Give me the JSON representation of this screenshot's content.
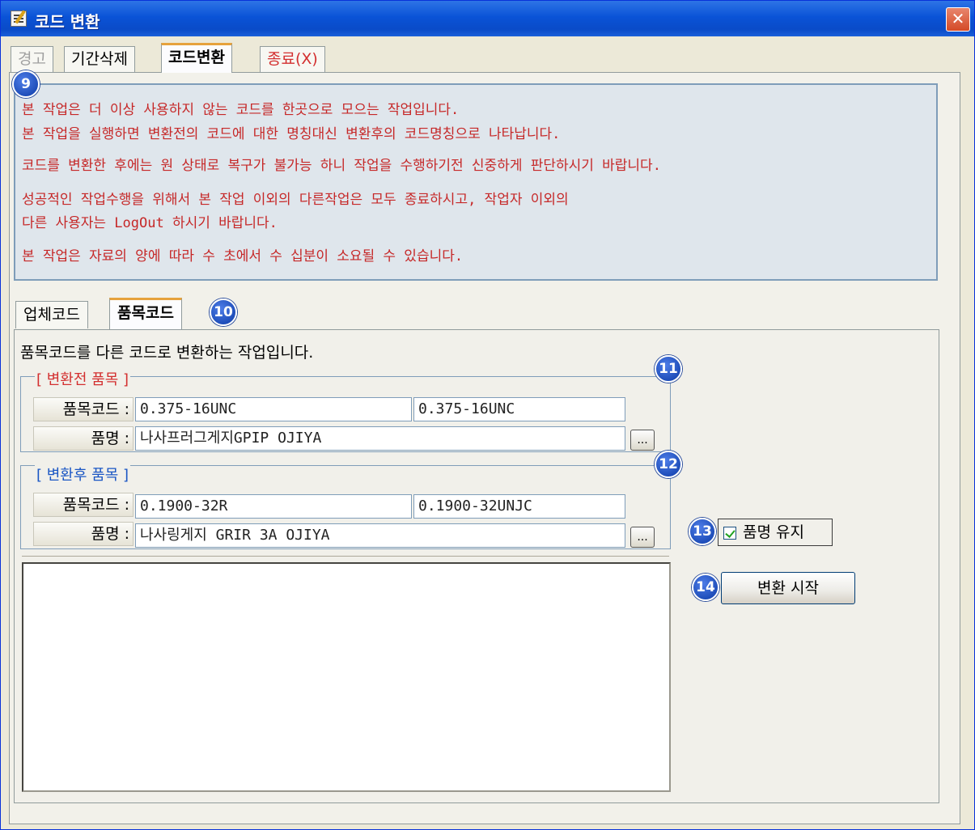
{
  "window": {
    "title": "코드 변환",
    "close_label": "✕"
  },
  "top_tabs": [
    {
      "label": "경고",
      "state": "disabled"
    },
    {
      "label": "기간삭제",
      "state": "normal"
    },
    {
      "label": "코드변환",
      "state": "active"
    },
    {
      "label": "종료(X)",
      "state": "red"
    }
  ],
  "notice": {
    "badge": "9",
    "lines": [
      "본 작업은 더 이상 사용하지 않는 코드를 한곳으로 모으는 작업입니다.",
      " 본 작업을 실행하면 변환전의 코드에 대한 명칭대신 변환후의 코드명칭으로 나타납니다.",
      "코드를 변환한 후에는 원 상태로 복구가 불가능 하니 작업을 수행하기전 신중하게 판단하시기 바랍니다.",
      "성공적인 작업수행을 위해서 본 작업 이외의 다른작업은 모두 종료하시고, 작업자 이외의",
      " 다른 사용자는 LogOut 하시기 바랍니다.",
      "본 작업은 자료의 양에 따라 수 초에서 수 십분이 소요될 수 있습니다."
    ]
  },
  "inner_tabs": [
    {
      "label": "업체코드",
      "state": "normal"
    },
    {
      "label": "품목코드",
      "state": "active"
    }
  ],
  "inner_tabs_badge": "10",
  "description": "품목코드를 다른 코드로 변환하는 작업입니다.",
  "before_group": {
    "title": "[ 변환전 품목 ]",
    "badge": "11",
    "code_label": "품목코드 :",
    "code_value": "0.375-16UNC",
    "code_value2": "0.375-16UNC",
    "name_label": "품명 :",
    "name_value": "나사프러그게지GPIP      OJIYA",
    "browse_label": "..."
  },
  "after_group": {
    "title": "[ 변환후 품목 ]",
    "badge": "12",
    "code_label": "품목코드 :",
    "code_value": "0.1900-32R",
    "code_value2": "0.1900-32UNJC",
    "name_label": "품명 :",
    "name_value": "나사링게지  GRIR 3A     OJIYA",
    "browse_label": "..."
  },
  "keep_name": {
    "badge": "13",
    "label": "품명 유지",
    "checked": true
  },
  "start": {
    "badge": "14",
    "label": "변환 시작"
  },
  "log_text": "",
  "colors": {
    "notice_text": "#c62828",
    "title_bar": "#0a53d7",
    "badge": "#0b3aa6"
  }
}
